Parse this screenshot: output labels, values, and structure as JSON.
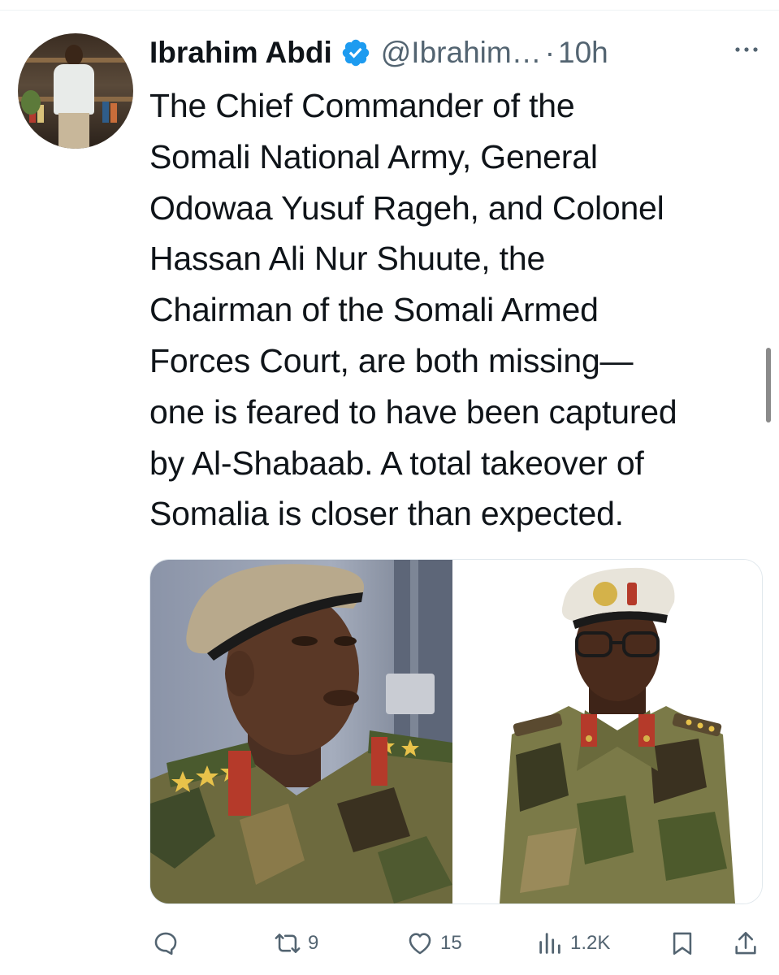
{
  "tweet": {
    "author": {
      "name": "Ibrahim Abdi",
      "handle": "@Ibrahim…",
      "verified": true
    },
    "separator": "·",
    "time": "10h",
    "text_lines": [
      "The Chief Commander of the",
      "Somali National Army, General",
      "Odowaa Yusuf Rageh, and Colonel",
      "Hassan Ali Nur Shuute, the",
      "Chairman of the Somali Armed",
      "Forces Court, are both missing—",
      "one is feared to have been captured",
      "by Al-Shabaab. A total takeover of",
      "Somalia is closer than expected."
    ],
    "media": {
      "count": 2,
      "items": [
        "photo-officer-left",
        "photo-officer-right"
      ]
    },
    "actions": {
      "reply": {
        "icon": "reply-icon",
        "count": ""
      },
      "retweet": {
        "icon": "retweet-icon",
        "count": "9"
      },
      "like": {
        "icon": "heart-icon",
        "count": "15"
      },
      "views": {
        "icon": "analytics-icon",
        "count": "1.2K"
      },
      "bookmark": {
        "icon": "bookmark-icon"
      },
      "share": {
        "icon": "share-icon"
      }
    }
  },
  "colors": {
    "text": "#0f1419",
    "secondary": "#536471",
    "verified_badge": "#1d9bf0",
    "background": "#ffffff"
  }
}
